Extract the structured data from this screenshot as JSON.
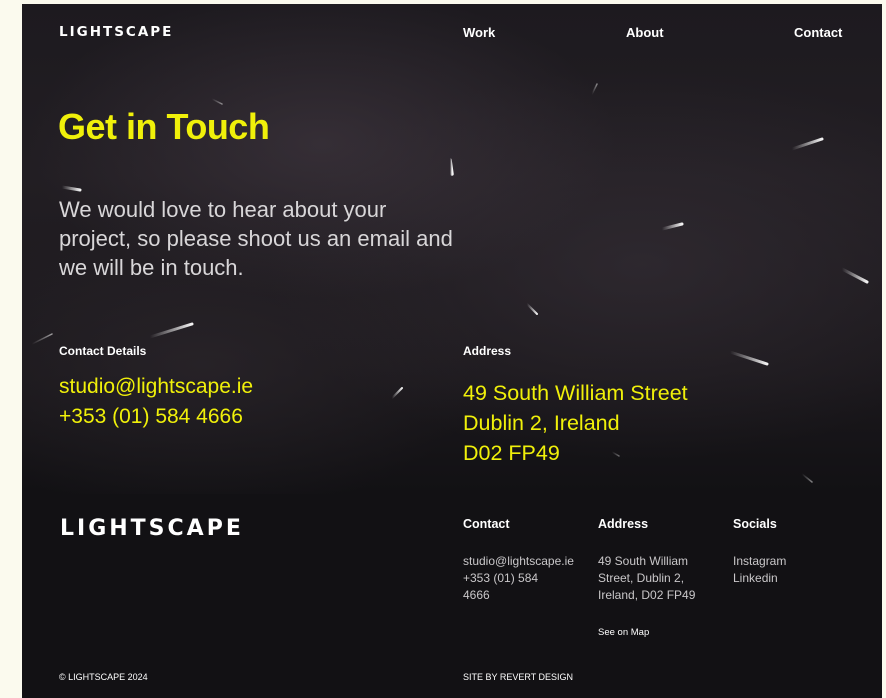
{
  "header": {
    "logo": "LIGHTSCAPE",
    "nav": [
      "Work",
      "About",
      "Contact"
    ]
  },
  "hero": {
    "title": "Get in Touch",
    "intro": "We would love to hear about your project, so please shoot us an email and we will be in touch.",
    "contact_label": "Contact Details",
    "email": "studio@lightscape.ie",
    "phone": "+353 (01) 584 4666",
    "address_label": "Address",
    "address_lines": [
      "49 South William Street",
      "Dublin 2, Ireland",
      "D02 FP49"
    ]
  },
  "footer": {
    "logo": "LIGHTSCAPE",
    "contact_heading": "Contact",
    "contact_email": "studio@lightscape.ie",
    "contact_phone": "+353 (01) 584 4666",
    "address_heading": "Address",
    "address_text": "49 South William Street, Dublin 2, Ireland, D02 FP49",
    "see_on_map": "See on Map",
    "socials_heading": "Socials",
    "socials": [
      "Instagram",
      "Linkedin"
    ],
    "copyright": "© LIGHTSCAPE 2024",
    "credit": "SITE BY REVERT DESIGN"
  },
  "colors": {
    "accent": "#f0f00a",
    "background": "#121114",
    "page_margin": "#fbfaee"
  }
}
